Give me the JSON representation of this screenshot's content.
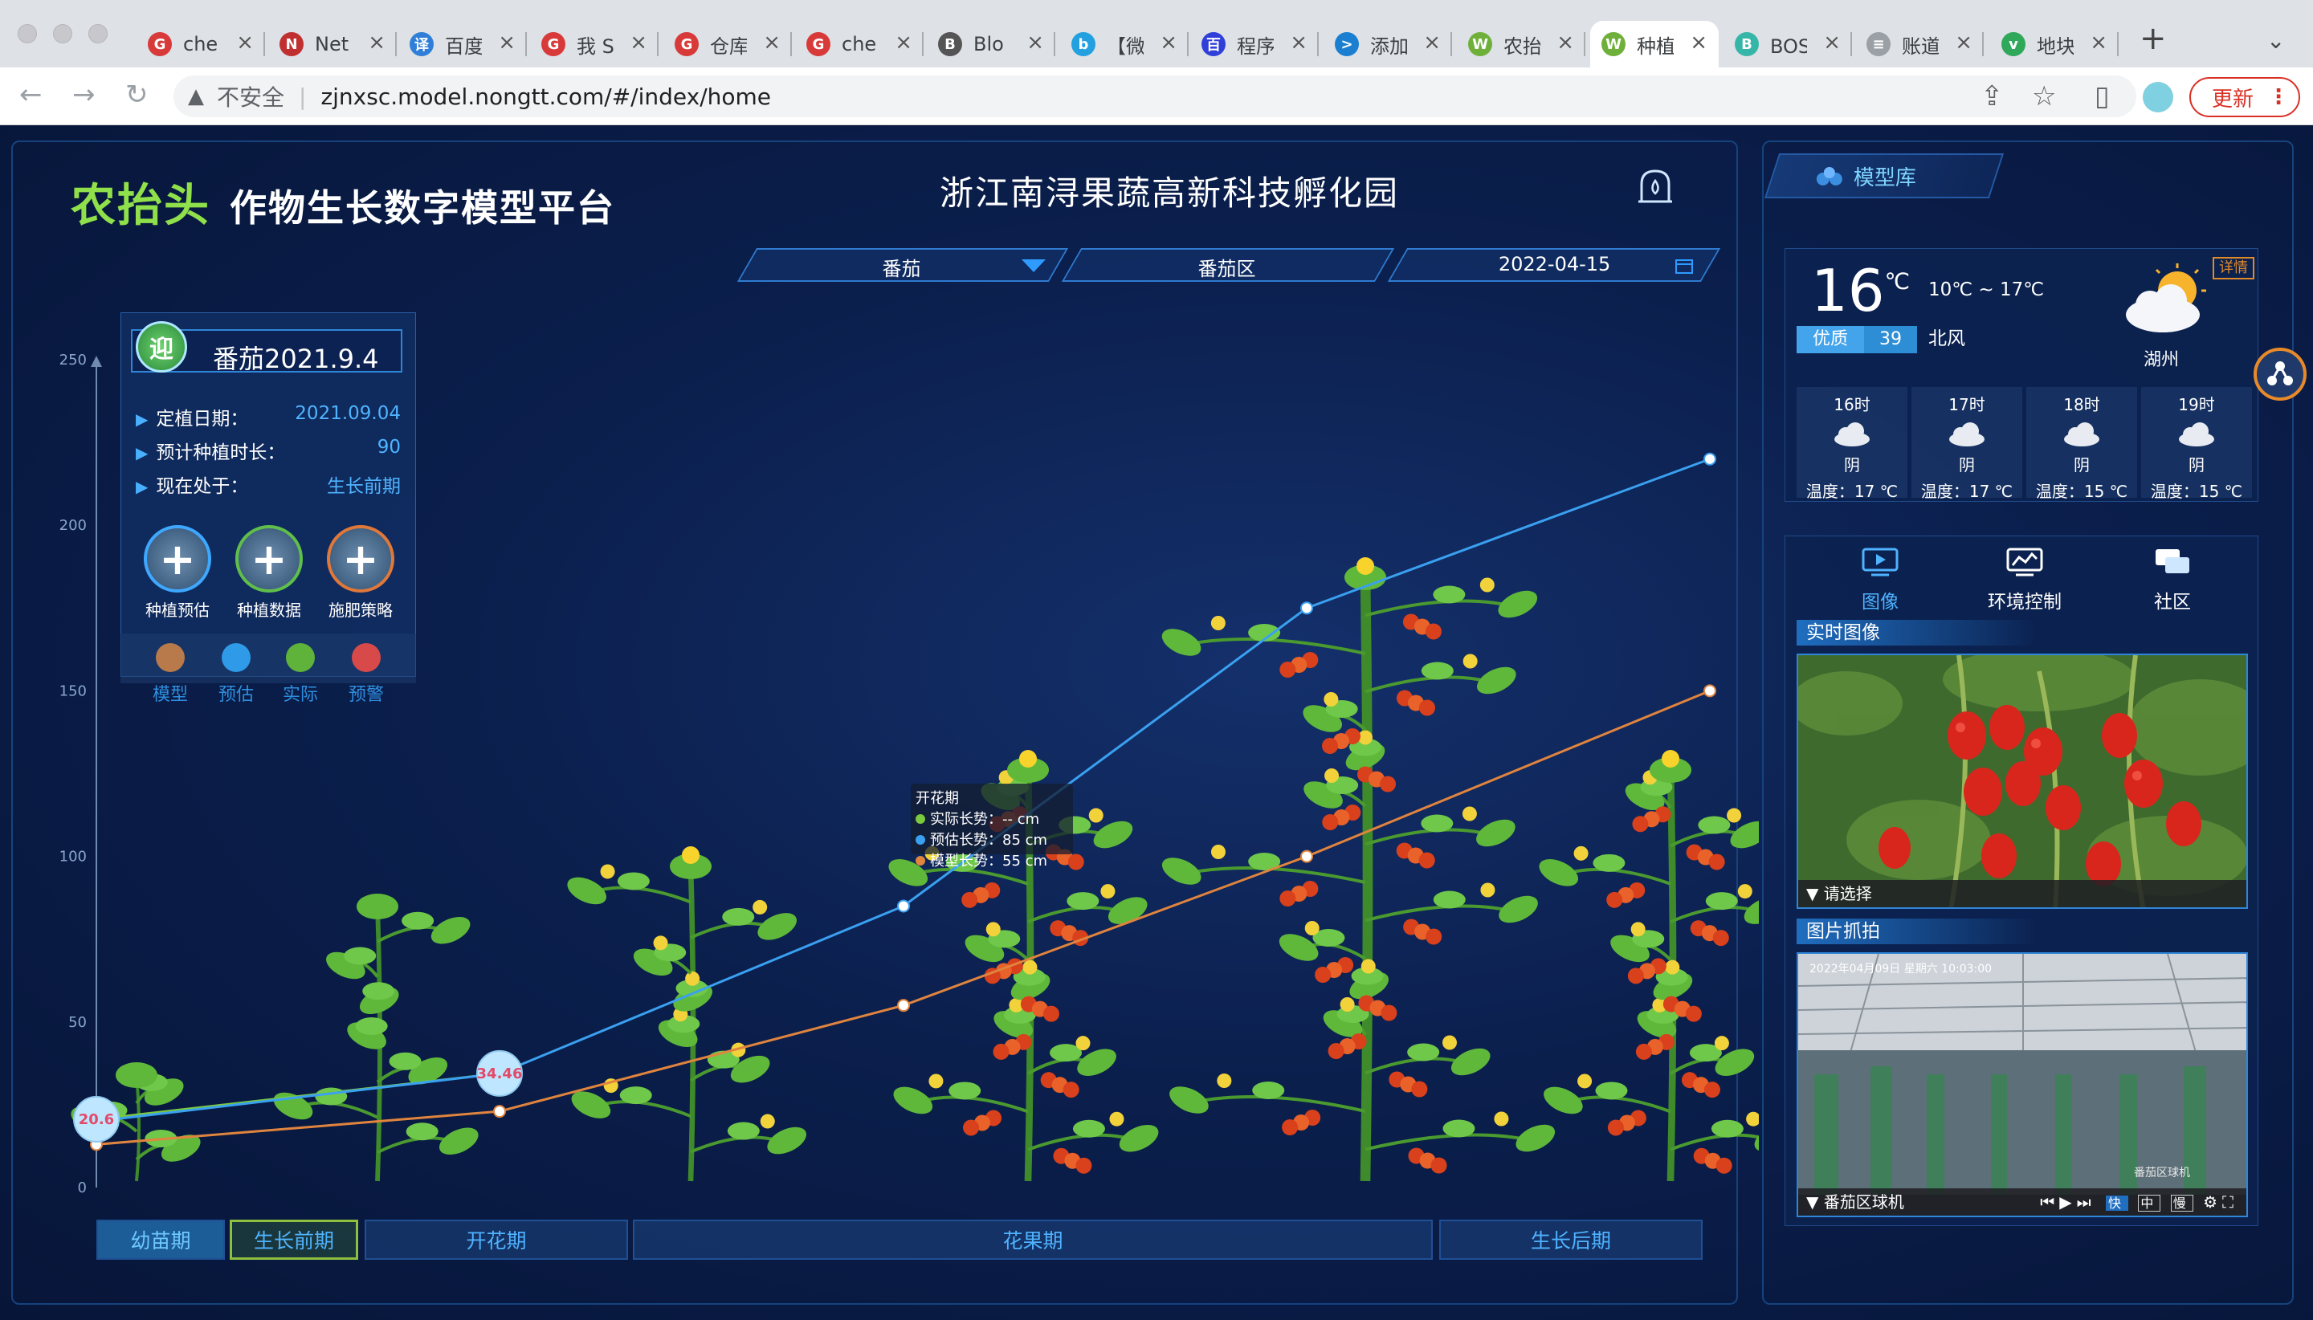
{
  "browser": {
    "tabs": [
      {
        "title": "che",
        "color": "#d83a3a",
        "glyph": "G"
      },
      {
        "title": "Net",
        "color": "#c03030",
        "glyph": "N"
      },
      {
        "title": "百度",
        "color": "#2f7fd8",
        "glyph": "译"
      },
      {
        "title": "我 S",
        "color": "#d83a3a",
        "glyph": "G"
      },
      {
        "title": "仓库",
        "color": "#d83a3a",
        "glyph": "G"
      },
      {
        "title": "che",
        "color": "#d83a3a",
        "glyph": "G"
      },
      {
        "title": "Blo",
        "color": "#555555",
        "glyph": "B"
      },
      {
        "title": "【微",
        "color": "#22a0e0",
        "glyph": "b"
      },
      {
        "title": "程序",
        "color": "#2f3fd8",
        "glyph": "百"
      },
      {
        "title": "添加项目",
        "color": "#1a7fd0",
        "glyph": ">"
      },
      {
        "title": "农抬头",
        "color": "#6fb03a",
        "glyph": "W"
      },
      {
        "title": "种植",
        "color": "#6fb03a",
        "glyph": "W"
      },
      {
        "title": "BOSS直",
        "color": "#36b6a8",
        "glyph": "B"
      },
      {
        "title": "账道 - ",
        "color": "#9aa0a6",
        "glyph": "≡"
      },
      {
        "title": "地块管理",
        "color": "#2fa85a",
        "glyph": "v"
      }
    ],
    "url": "zjnxsc.model.nongtt.com/#/index/home",
    "not_secure": "不安全",
    "update_label": "更新"
  },
  "header": {
    "logo": "农抬头",
    "app_title": "作物生长数字模型平台",
    "park_title": "浙江南浔果蔬高新科技孵化园",
    "model_lib": "模型库"
  },
  "filters": {
    "crop": "番茄",
    "zone": "番茄区",
    "date": "2022-04-15"
  },
  "crop_info": {
    "badge": "迎",
    "name": "番茄2021.9.4",
    "rows": [
      {
        "label": "定植日期：",
        "value": "2021.09.04"
      },
      {
        "label": "预计种植时长：",
        "value": "90"
      },
      {
        "label": "现在处于：",
        "value": "生长前期"
      }
    ],
    "actions": [
      {
        "label": "种植预估",
        "ring": "#3ea8ff"
      },
      {
        "label": "种植数据",
        "ring": "#5fbf4a"
      },
      {
        "label": "施肥策略",
        "ring": "#e0783a"
      }
    ]
  },
  "legend": [
    {
      "label": "模型",
      "color": "#b87a4a"
    },
    {
      "label": "预估",
      "color": "#2e9ae8"
    },
    {
      "label": "实际",
      "color": "#5fb33a"
    },
    {
      "label": "预警",
      "color": "#d84a4a"
    }
  ],
  "chart_data": {
    "type": "line",
    "ylim": [
      0,
      250
    ],
    "yticks": [
      0,
      50,
      100,
      150,
      200,
      250
    ],
    "x": [
      "幼苗期",
      "生长前期",
      "开花期",
      "花果期-1",
      "花果期-2",
      "生长后期"
    ],
    "series": [
      {
        "name": "实际",
        "color": "#7ac93e",
        "values": [
          20.6,
          34.46
        ]
      },
      {
        "name": "预估",
        "color": "#3aa0f0",
        "values": [
          20,
          34.46,
          85,
          175,
          220
        ]
      },
      {
        "name": "模型",
        "color": "#e0843e",
        "values": [
          13,
          23,
          55,
          100,
          150
        ]
      }
    ],
    "point_labels": [
      {
        "text": "20.6"
      },
      {
        "text": "34.46"
      }
    ],
    "tooltip": {
      "title": "开花期",
      "rows": [
        {
          "label": "实际长势：",
          "value": "-- cm",
          "color": "#7ac93e"
        },
        {
          "label": "预估长势：",
          "value": "85 cm",
          "color": "#3aa0f0"
        },
        {
          "label": "模型长势：",
          "value": "55 cm",
          "color": "#e0843e"
        }
      ]
    }
  },
  "stages": [
    "幼苗期",
    "生长前期",
    "开花期",
    "花果期",
    "生长后期"
  ],
  "weather": {
    "temp": "16",
    "unit": "℃",
    "range": "10℃ ~ 17℃",
    "aqi_label": "优质",
    "aqi_value": "39",
    "wind": "北风",
    "city": "湖州",
    "detail": "详情",
    "hours": [
      {
        "h": "16时",
        "w": "阴",
        "t": "温度：17 ℃"
      },
      {
        "h": "17时",
        "w": "阴",
        "t": "温度：17 ℃"
      },
      {
        "h": "18时",
        "w": "阴",
        "t": "温度：15 ℃"
      },
      {
        "h": "19时",
        "w": "阴",
        "t": "温度：15 ℃"
      }
    ]
  },
  "media": {
    "tabs": [
      "图像",
      "环境控制",
      "社区"
    ],
    "live_title": "实时图像",
    "live_select": "请选择",
    "capture_title": "图片抓拍",
    "capture_camera": "番茄区球机",
    "capture_timestamp": "2022年04月09日 星期六 10:03:00",
    "capture_watermark": "番茄区球机",
    "player": {
      "fast": "快",
      "mid": "中",
      "slow": "慢"
    }
  }
}
